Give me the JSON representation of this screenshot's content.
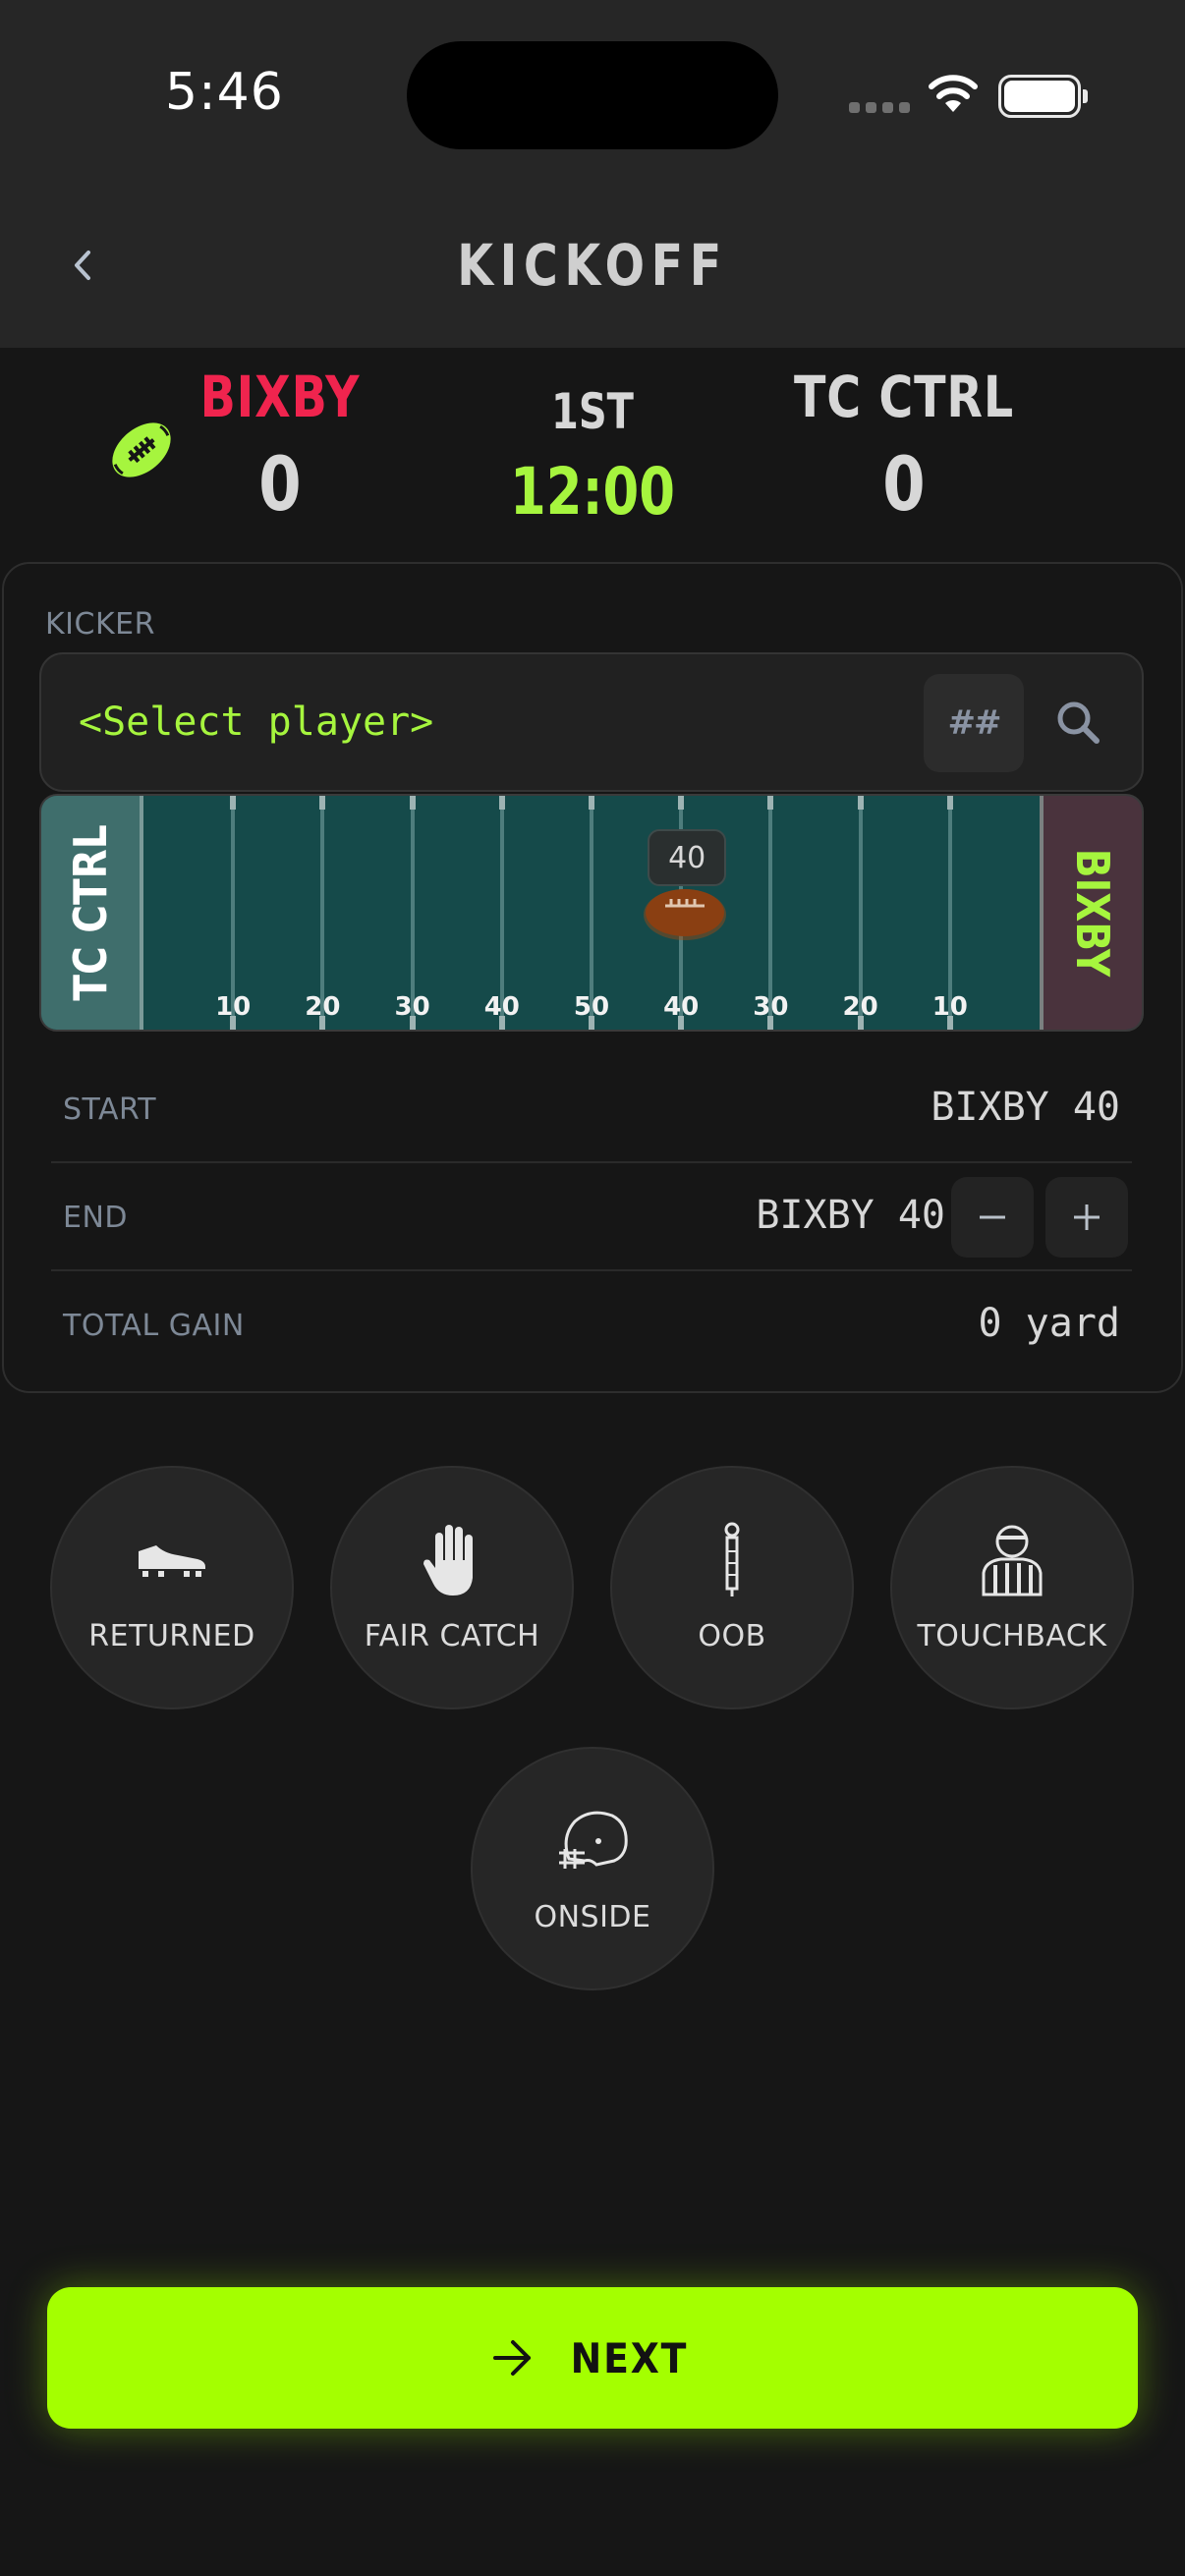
{
  "status_bar": {
    "time": "5:46"
  },
  "header": {
    "title": "KICKOFF",
    "back_icon": "chevron-left-icon"
  },
  "scoreboard": {
    "home": {
      "name": "BIXBY",
      "score": "0",
      "color": "#f0244e"
    },
    "away": {
      "name": "TC CTRL",
      "score": "0"
    },
    "period": "1ST",
    "clock": "12:00",
    "clock_color": "#a6f53e",
    "icon": "football-icon"
  },
  "kicker": {
    "label": "KICKER",
    "placeholder": "<Select player>",
    "number_button": "##",
    "search_icon": "search-icon"
  },
  "field": {
    "left_endzone": "TC CTRL",
    "right_endzone": "BIXBY",
    "yard_labels": [
      "10",
      "20",
      "30",
      "40",
      "50",
      "40",
      "30",
      "20",
      "10"
    ],
    "ball_marker": "40",
    "ball_position_yard_index": 5
  },
  "details": {
    "start": {
      "label": "START",
      "value": "BIXBY 40"
    },
    "end": {
      "label": "END",
      "value": "BIXBY 40",
      "minus": "−",
      "plus": "+"
    },
    "total": {
      "label": "TOTAL GAIN",
      "value": "0 yard"
    }
  },
  "outcomes": {
    "returned": {
      "label": "RETURNED",
      "icon": "cleat-icon"
    },
    "fair_catch": {
      "label": "FAIR CATCH",
      "icon": "hand-icon"
    },
    "oob": {
      "label": "OOB",
      "icon": "down-marker-icon"
    },
    "touchback": {
      "label": "TOUCHBACK",
      "icon": "referee-icon"
    },
    "onside": {
      "label": "ONSIDE",
      "icon": "helmet-icon"
    }
  },
  "next_button": {
    "label": "NEXT",
    "icon": "arrow-right-icon",
    "color": "#a4ff00"
  }
}
